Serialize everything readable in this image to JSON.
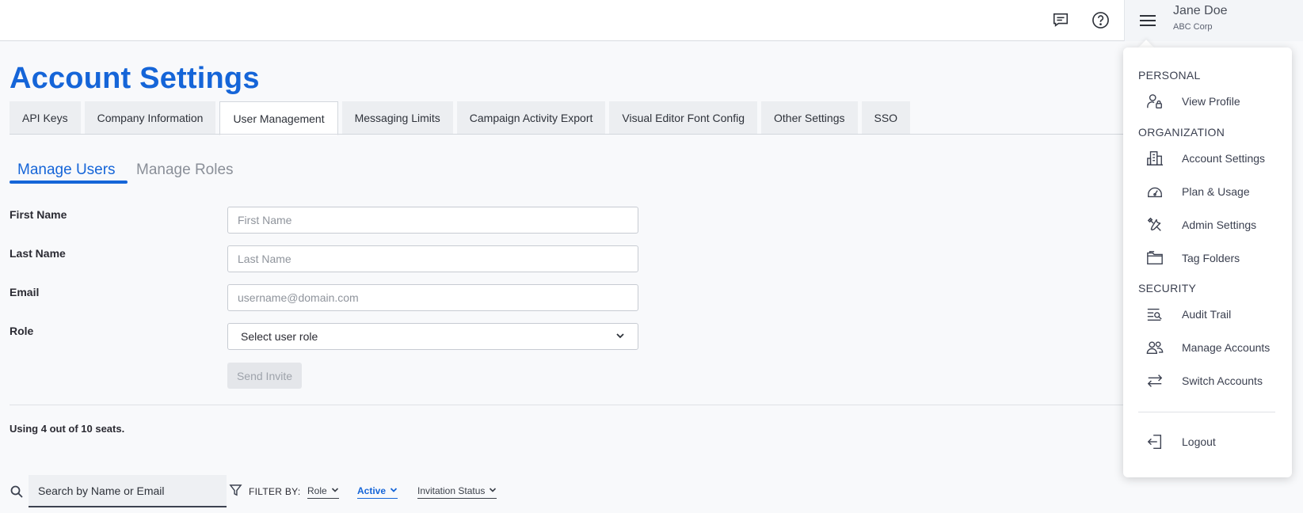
{
  "header": {
    "user_name": "Jane Doe",
    "user_org": "ABC Corp",
    "icons": [
      "chat-icon",
      "help-icon",
      "hamburger-menu-icon"
    ]
  },
  "page": {
    "title": "Account Settings"
  },
  "tabs": [
    {
      "label": "API Keys",
      "active": false
    },
    {
      "label": "Company Information",
      "active": false
    },
    {
      "label": "User Management",
      "active": true
    },
    {
      "label": "Messaging Limits",
      "active": false
    },
    {
      "label": "Campaign Activity Export",
      "active": false
    },
    {
      "label": "Visual Editor Font Config",
      "active": false
    },
    {
      "label": "Other Settings",
      "active": false
    },
    {
      "label": "SSO",
      "active": false
    }
  ],
  "subtabs": {
    "manage_users": "Manage Users",
    "manage_roles": "Manage Roles"
  },
  "form": {
    "first_name_label": "First Name",
    "first_name_placeholder": "First Name",
    "first_name_value": "",
    "last_name_label": "Last Name",
    "last_name_placeholder": "Last Name",
    "last_name_value": "",
    "email_label": "Email",
    "email_placeholder": "username@domain.com",
    "email_value": "",
    "role_label": "Role",
    "role_selected": "Select user role",
    "send_invite": "Send Invite"
  },
  "seats_text": "Using 4 out of 10 seats.",
  "filters": {
    "search_placeholder": "Search by Name or Email",
    "filter_by_label": "FILTER BY:",
    "role": "Role",
    "active": "Active",
    "invitation_status": "Invitation Status"
  },
  "menu": {
    "sections": {
      "personal": "PERSONAL",
      "organization": "ORGANIZATION",
      "security": "SECURITY"
    },
    "items": {
      "view_profile": "View Profile",
      "account_settings": "Account Settings",
      "plan_usage": "Plan & Usage",
      "admin_settings": "Admin Settings",
      "tag_folders": "Tag Folders",
      "audit_trail": "Audit Trail",
      "manage_accounts": "Manage Accounts",
      "switch_accounts": "Switch Accounts",
      "logout": "Logout"
    }
  },
  "colors": {
    "accent": "#1565d8",
    "text": "#2b2b33",
    "background": "#f8f9fb"
  }
}
